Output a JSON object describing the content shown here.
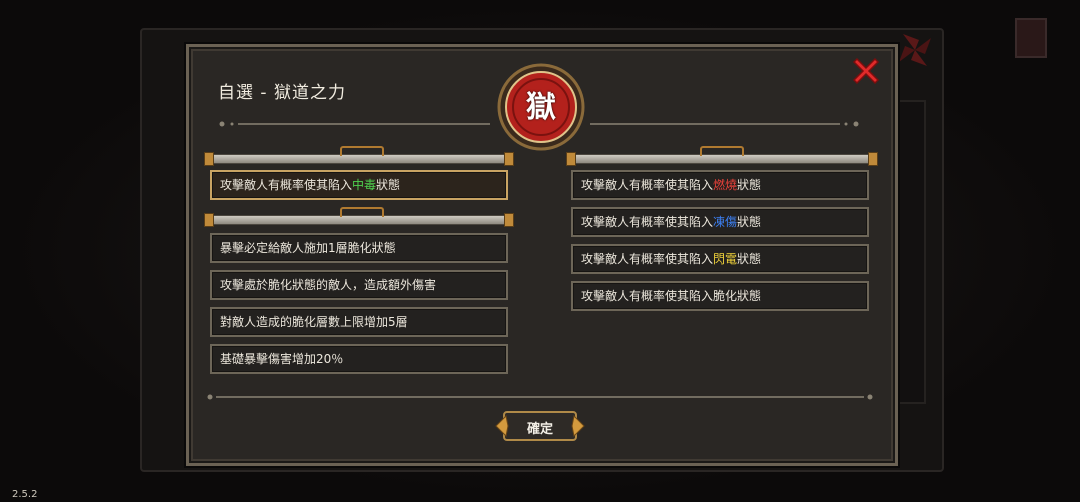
{
  "version": "2.5.2",
  "dialog": {
    "title": "自選 - 獄道之力",
    "emblem_char": "獄",
    "confirm_label": "確定"
  },
  "left_group_1": [
    {
      "before": "攻擊敵人有概率使其陷入",
      "highlight": "中毒",
      "after": "狀態",
      "highlight_color": "#4fd24f",
      "selected": true
    }
  ],
  "left_group_2": [
    {
      "before": "暴擊必定給敵人施加1層脆化狀態",
      "highlight": "",
      "after": ""
    },
    {
      "before": "攻擊處於脆化狀態的敵人，造成額外傷害",
      "highlight": "",
      "after": ""
    },
    {
      "before": "對敵人造成的脆化層數上限增加5層",
      "highlight": "",
      "after": ""
    },
    {
      "before": "基礎暴擊傷害增加20％",
      "highlight": "",
      "after": ""
    }
  ],
  "right_group": [
    {
      "before": "攻擊敵人有概率使其陷入",
      "highlight": "燃燒",
      "after": "狀態",
      "highlight_color": "#e8413a"
    },
    {
      "before": "攻擊敵人有概率使其陷入",
      "highlight": "凍傷",
      "after": "狀態",
      "highlight_color": "#3c7ff0"
    },
    {
      "before": "攻擊敵人有概率使其陷入",
      "highlight": "閃電",
      "after": "狀態",
      "highlight_color": "#f0d23a"
    },
    {
      "before": "攻擊敵人有概率使其陷入脆化狀態",
      "highlight": "",
      "after": ""
    }
  ],
  "colors": {
    "panel_bg": "#2a2724",
    "border": "#6b6254",
    "selected_border": "#c9a463",
    "close_red": "#e02a2a",
    "emblem_red": "#b3211c"
  }
}
